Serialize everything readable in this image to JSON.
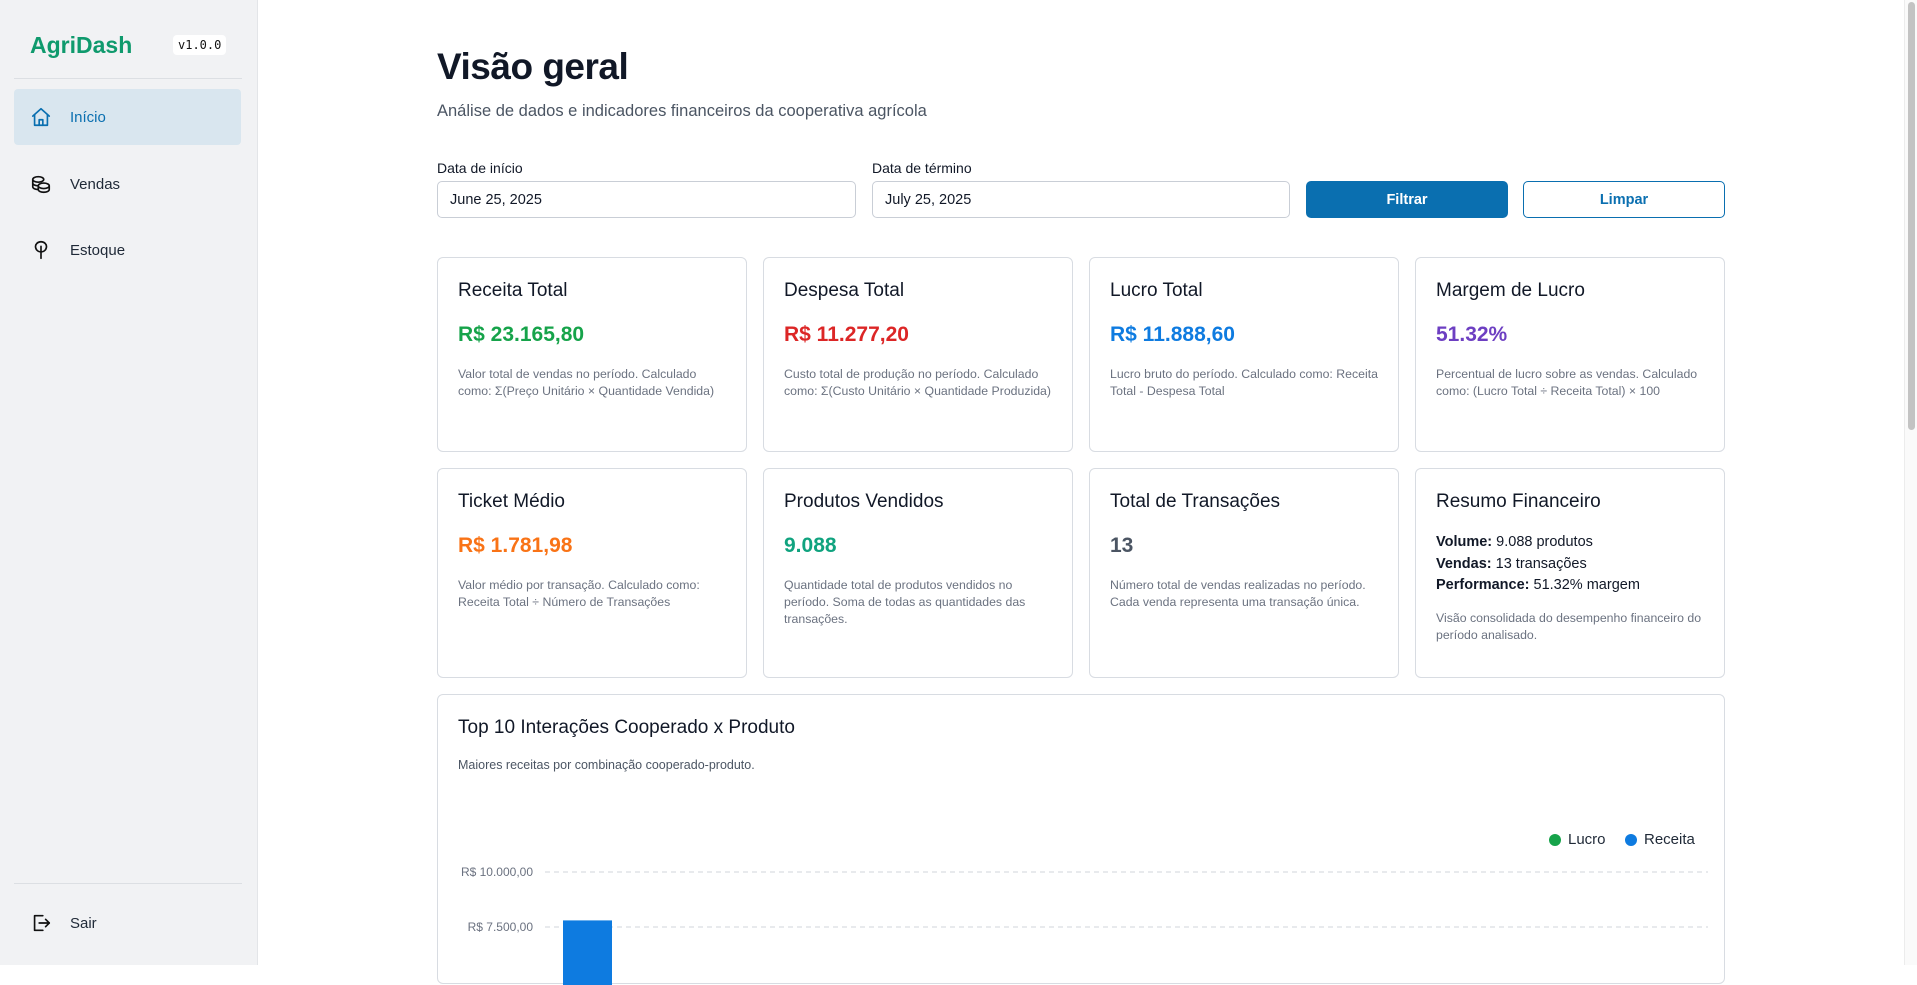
{
  "sidebar": {
    "brand": "AgriDash",
    "version": "v1.0.0",
    "items": [
      {
        "label": "Início",
        "icon": "home-icon",
        "active": true
      },
      {
        "label": "Vendas",
        "icon": "coins-icon",
        "active": false
      },
      {
        "label": "Estoque",
        "icon": "sprout-icon",
        "active": false
      }
    ],
    "logout": {
      "label": "Sair",
      "icon": "logout-icon"
    }
  },
  "header": {
    "title": "Visão geral",
    "subtitle": "Análise de dados e indicadores financeiros da cooperativa agrícola"
  },
  "filters": {
    "start_label": "Data de início",
    "start_value": "June 25, 2025",
    "end_label": "Data de término",
    "end_value": "July 25, 2025",
    "filter_button": "Filtrar",
    "clear_button": "Limpar"
  },
  "colors": {
    "brand": "#0f9a6d",
    "primary": "#0a6fb0",
    "green": "#16a34a",
    "red": "#dc2626",
    "blue": "#0e7be0",
    "purple": "#6d3fc2",
    "orange": "#f97316",
    "teal": "#10a37f",
    "gray": "#4b5563"
  },
  "cards": [
    {
      "title": "Receita Total",
      "value": "R$ 23.165,80",
      "color": "#16a34a",
      "desc": "Valor total de vendas no período. Calculado como: Σ(Preço Unitário × Quantidade Vendida)"
    },
    {
      "title": "Despesa Total",
      "value": "R$ 11.277,20",
      "color": "#dc2626",
      "desc": "Custo total de produção no período. Calculado como: Σ(Custo Unitário × Quantidade Produzida)"
    },
    {
      "title": "Lucro Total",
      "value": "R$ 11.888,60",
      "color": "#0e7be0",
      "desc": "Lucro bruto do período. Calculado como: Receita Total - Despesa Total"
    },
    {
      "title": "Margem de Lucro",
      "value": "51.32%",
      "color": "#6d3fc2",
      "desc": "Percentual de lucro sobre as vendas. Calculado como: (Lucro Total ÷ Receita Total) × 100"
    },
    {
      "title": "Ticket Médio",
      "value": "R$ 1.781,98",
      "color": "#f97316",
      "desc": "Valor médio por transação. Calculado como: Receita Total ÷ Número de Transações"
    },
    {
      "title": "Produtos Vendidos",
      "value": "9.088",
      "color": "#10a37f",
      "desc": "Quantidade total de produtos vendidos no período. Soma de todas as quantidades das transações."
    },
    {
      "title": "Total de Transações",
      "value": "13",
      "color": "#4b5563",
      "desc": "Número total de vendas realizadas no período. Cada venda representa uma transação única."
    }
  ],
  "summary": {
    "title": "Resumo Financeiro",
    "volume_label": "Volume:",
    "volume_value": "9.088 produtos",
    "sales_label": "Vendas:",
    "sales_value": "13 transações",
    "performance_label": "Performance:",
    "performance_value": "51.32% margem",
    "desc": "Visão consolidada do desempenho financeiro do período analisado."
  },
  "chart": {
    "title": "Top 10 Interações Cooperado x Produto",
    "subtitle": "Maiores receitas por combinação cooperado-produto."
  },
  "chart_data": {
    "type": "bar",
    "title": "Top 10 Interações Cooperado x Produto",
    "subtitle": "Maiores receitas por combinação cooperado-produto.",
    "legend": [
      "Lucro",
      "Receita"
    ],
    "legend_placement": "top-right",
    "series_colors": {
      "Lucro": "#16a34a",
      "Receita": "#0e7be0"
    },
    "y_ticks": [
      {
        "value": 10000,
        "label": "R$ 10.000,00"
      },
      {
        "value": 7500,
        "label": "R$ 7.500,00"
      }
    ],
    "ylim": [
      0,
      10000
    ],
    "grid": true,
    "series": [
      {
        "name": "Receita",
        "values": [
          7800
        ]
      }
    ]
  }
}
